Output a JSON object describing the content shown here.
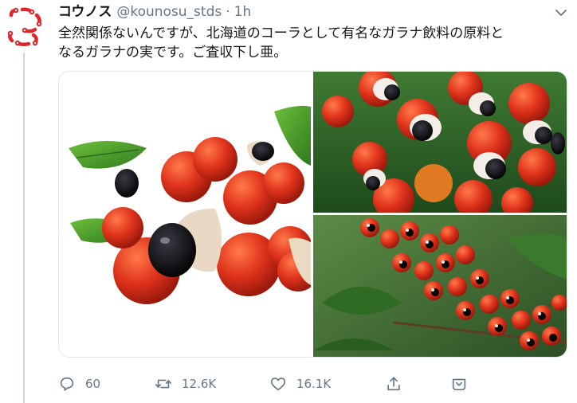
{
  "tweet": {
    "display_name": "コウノス",
    "handle": "@kounosu_stds",
    "separator": "·",
    "time": "1h",
    "text_line1": "全然関係ないんですが、北海道のコーラとして有名なガラナ飲料の原料と",
    "text_line2": "なるガラナの実です。ご査収下し亜。"
  },
  "actions": {
    "reply_count": "60",
    "retweet_count": "12.6K",
    "like_count": "16.1K"
  },
  "media": {
    "image_count": 3
  },
  "icons": {
    "avatar": "red-chain-logo-icon",
    "reply": "reply-icon",
    "retweet": "retweet-icon",
    "like": "heart-icon",
    "share": "share-icon",
    "more": "chevron-down-icon"
  },
  "colors": {
    "icon_gray": "#657786",
    "text": "#14171a",
    "avatar_red": "#e0262b",
    "border": "#e1e8ed"
  }
}
